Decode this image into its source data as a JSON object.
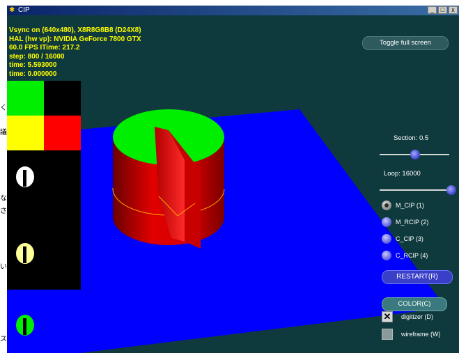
{
  "window": {
    "title": "CIP",
    "buttons": [
      "_",
      "□",
      "x"
    ]
  },
  "stats": {
    "line1": "Vsync on (640x480), X8R8G8B8 (D24X8)",
    "line2": "HAL (hw vp): NVIDIA GeForce 7800 GTX",
    "line3": "60.0 FPS  ITime: 217.2",
    "line4": "step: 800 / 16000",
    "line5": "time: 5.593000",
    "line6": "time: 0.000000"
  },
  "controls": {
    "toggle_label": "Toggle full screen",
    "section_label": "Section: 0.5",
    "section_value": 0.5,
    "loop_label": "Loop: 16000",
    "loop_value": 1.0,
    "radios": [
      {
        "label": "M_CIP (1)",
        "selected": true
      },
      {
        "label": "M_RCIP (2)",
        "selected": false
      },
      {
        "label": "C_CIP (3)",
        "selected": false
      },
      {
        "label": "C_RCIP (4)",
        "selected": false
      }
    ],
    "restart_label": "RESTART(R)",
    "color_label": "COLOR(C)",
    "checkboxes": [
      {
        "label": "digitizer (D)",
        "checked": true
      },
      {
        "label": "wireframe (W)",
        "checked": false
      }
    ]
  },
  "colors": {
    "background": "#0f3a3d",
    "plane": "#0000ff",
    "cylinder_top": "#00ee00",
    "cylinder_side": "#dd0000",
    "stats_text": "#ffff00"
  },
  "outside_chars": [
    "く",
    "議",
    "な",
    "さ",
    "い",
    "ス"
  ]
}
